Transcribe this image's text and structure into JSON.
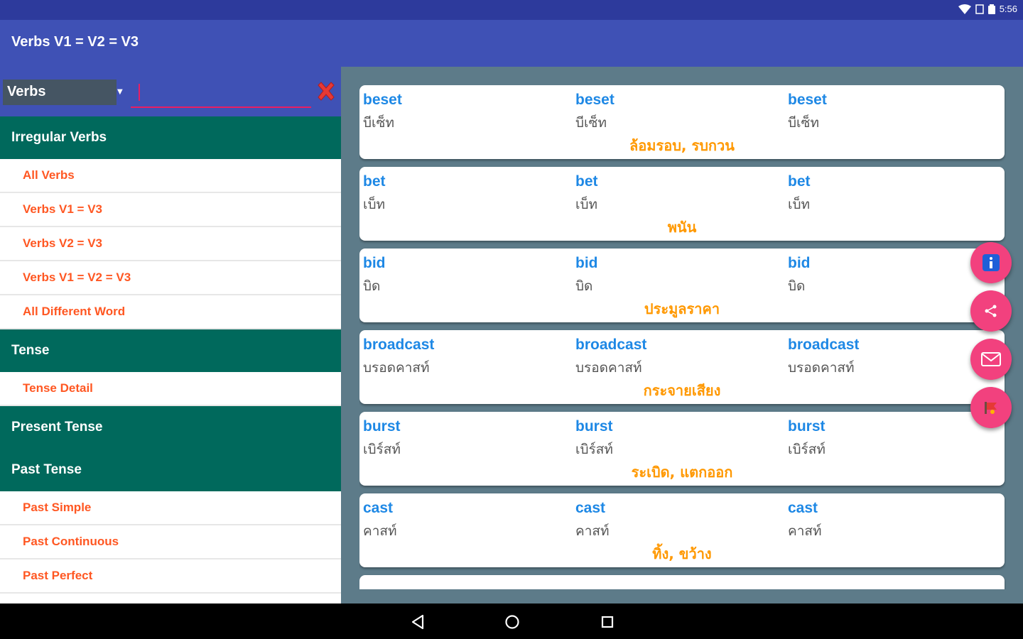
{
  "status": {
    "time": "5:56"
  },
  "app": {
    "title": "Verbs V1 = V2 = V3"
  },
  "search": {
    "category_selected": "Verbs",
    "query": ""
  },
  "sidebar": {
    "sections": [
      {
        "header": "Irregular Verbs",
        "items": [
          "All Verbs",
          "Verbs V1 = V3",
          "Verbs V2 = V3",
          "Verbs V1 = V2 = V3",
          "All Different Word"
        ]
      },
      {
        "header": "Tense",
        "items": [
          "Tense Detail"
        ]
      },
      {
        "header": "Present Tense",
        "items": []
      },
      {
        "header": "Past Tense",
        "items": [
          "Past Simple",
          "Past Continuous",
          "Past Perfect"
        ]
      }
    ]
  },
  "verbs": [
    {
      "v1": "beset",
      "v2": "beset",
      "v3": "beset",
      "r1": "บีเซ็ท",
      "r2": "บีเซ็ท",
      "r3": "บีเซ็ท",
      "meaning": "ล้อมรอบ, รบกวน"
    },
    {
      "v1": "bet",
      "v2": "bet",
      "v3": "bet",
      "r1": "เบ็ท",
      "r2": "เบ็ท",
      "r3": "เบ็ท",
      "meaning": "พนัน"
    },
    {
      "v1": "bid",
      "v2": "bid",
      "v3": "bid",
      "r1": "บิด",
      "r2": "บิด",
      "r3": "บิด",
      "meaning": "ประมูลราคา"
    },
    {
      "v1": "broadcast",
      "v2": "broadcast",
      "v3": "broadcast",
      "r1": "บรอดคาสท์",
      "r2": "บรอดคาสท์",
      "r3": "บรอดคาสท์",
      "meaning": "กระจายเสียง"
    },
    {
      "v1": "burst",
      "v2": "burst",
      "v3": "burst",
      "r1": "เบิร์สท์",
      "r2": "เบิร์สท์",
      "r3": "เบิร์สท์",
      "meaning": "ระเบิด, แตกออก"
    },
    {
      "v1": "cast",
      "v2": "cast",
      "v3": "cast",
      "r1": "คาสท์",
      "r2": "คาสท์",
      "r3": "คาสท์",
      "meaning": "ทิ้ง, ขว้าง"
    }
  ],
  "fabs": [
    "info-icon",
    "share-icon",
    "mail-icon",
    "rate-icon"
  ],
  "colors": {
    "primary": "#3f51b5",
    "section": "#00695c",
    "accent": "#f2417e",
    "verb": "#1e88e5",
    "meaning": "#ff9800",
    "menu": "#ff5722"
  }
}
